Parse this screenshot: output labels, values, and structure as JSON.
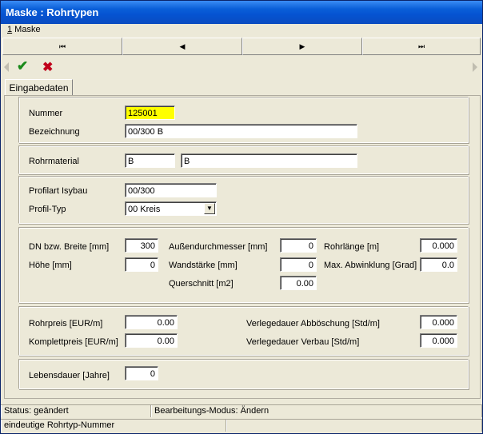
{
  "window": {
    "title": "Maske : Rohrtypen"
  },
  "menu": {
    "item1_mnemonic": "1",
    "item1_label": " Maske"
  },
  "nav": {
    "first": "⏮",
    "prev": "◀",
    "next": "▶",
    "last": "⏭"
  },
  "toolbar": {
    "ok": "✔",
    "cancel": "✖"
  },
  "tabs": [
    {
      "label": "Eingabedaten"
    }
  ],
  "fields": {
    "nummer": {
      "label": "Nummer",
      "value": "125001"
    },
    "bezeichnung": {
      "label": "Bezeichnung",
      "value": "00/300 B"
    },
    "rohrmaterial": {
      "label": "Rohrmaterial",
      "code": "B",
      "name": "B"
    },
    "profilart": {
      "label": "Profilart Isybau",
      "value": "00/300"
    },
    "profiltyp": {
      "label": "Profil-Typ",
      "value": "00 Kreis"
    },
    "dn_breite": {
      "label": "DN bzw. Breite [mm]",
      "value": "300"
    },
    "hoehe": {
      "label": "Höhe [mm]",
      "value": "0"
    },
    "aussendurchmesser": {
      "label": "Außendurchmesser [mm]",
      "value": "0"
    },
    "wandstaerke": {
      "label": "Wandstärke [mm]",
      "value": "0"
    },
    "querschnitt": {
      "label": "Querschnitt [m2]",
      "value": "0.00"
    },
    "rohrlaenge": {
      "label": "Rohrlänge [m]",
      "value": "0.000"
    },
    "abwinklung": {
      "label": "Max. Abwinklung [Grad]",
      "value": "0.0"
    },
    "rohrpreis": {
      "label": "Rohrpreis [EUR/m]",
      "value": "0.00"
    },
    "komplettpreis": {
      "label": "Komplettpreis [EUR/m]",
      "value": "0.00"
    },
    "verlege_boeschung": {
      "label": "Verlegedauer Abböschung [Std/m]",
      "value": "0.000"
    },
    "verlege_verbau": {
      "label": "Verlegedauer Verbau [Std/m]",
      "value": "0.000"
    },
    "lebensdauer": {
      "label": "Lebensdauer [Jahre]",
      "value": "0"
    }
  },
  "status": {
    "status": "Status: geändert",
    "mode": "Bearbeitungs-Modus: Ändern",
    "hint": "eindeutige Rohrtyp-Nummer"
  },
  "colors": {
    "title_bar": "#0a5fd8",
    "required_field": "#ffff00",
    "ok_icon": "#1a8a1a",
    "cancel_icon": "#c0001a"
  }
}
